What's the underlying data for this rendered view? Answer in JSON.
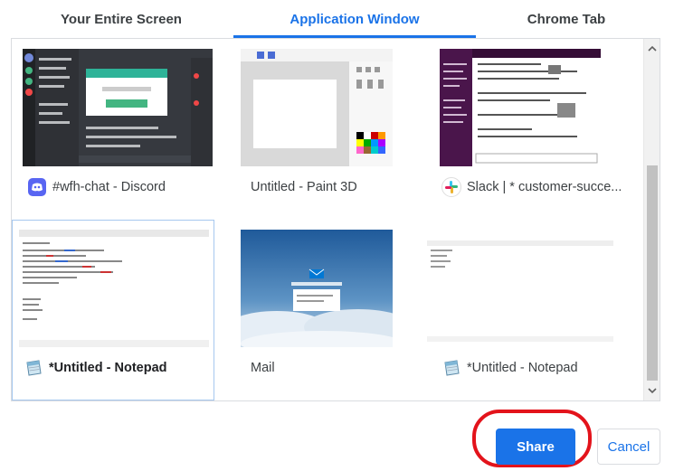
{
  "tabs": [
    {
      "label": "Your Entire Screen"
    },
    {
      "label": "Application Window"
    },
    {
      "label": "Chrome Tab"
    }
  ],
  "windows": [
    {
      "label": "#wfh-chat - Discord",
      "icon": "discord-icon",
      "selected": false
    },
    {
      "label": "Untitled - Paint 3D",
      "icon": "",
      "selected": false
    },
    {
      "label": "Slack | * customer-succe...",
      "icon": "slack-icon",
      "selected": false
    },
    {
      "label": "*Untitled - Notepad",
      "icon": "notepad-icon",
      "selected": true
    },
    {
      "label": "Mail",
      "icon": "",
      "selected": false
    },
    {
      "label": "*Untitled - Notepad",
      "icon": "notepad-icon",
      "selected": false
    }
  ],
  "buttons": {
    "share": "Share",
    "cancel": "Cancel"
  },
  "colors": {
    "accent": "#1a73e8",
    "highlight_ring": "#e3131b"
  }
}
